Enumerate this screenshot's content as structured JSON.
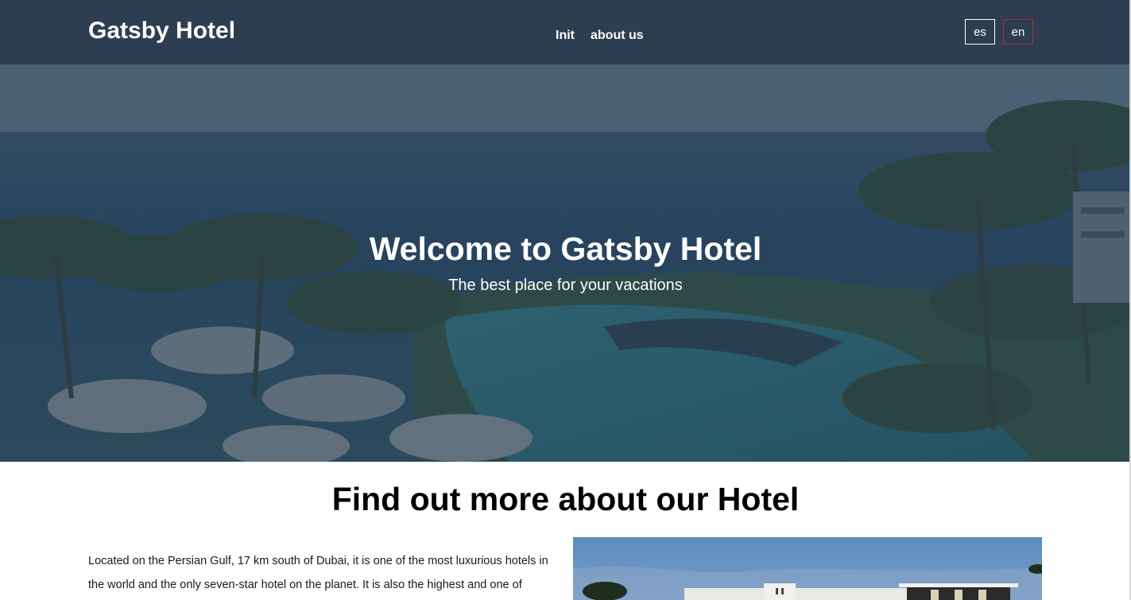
{
  "header": {
    "brand": "Gatsby Hotel",
    "nav": [
      {
        "label": "Init"
      },
      {
        "label": "about us"
      }
    ],
    "languages": [
      {
        "label": "es",
        "active": false
      },
      {
        "label": "en",
        "active": true
      }
    ]
  },
  "hero": {
    "title": "Welcome to Gatsby Hotel",
    "subtitle": "The best place for your vacations"
  },
  "about": {
    "title": "Find out more about our Hotel",
    "text": "Located on the Persian Gulf, 17 km south of Dubai, it is one of the most luxurious hotels in the world and the only seven-star hotel on the planet. It is also the highest and one of"
  },
  "colors": {
    "header_bg": "#2d3e50",
    "active_lang_border": "#c0282f"
  }
}
